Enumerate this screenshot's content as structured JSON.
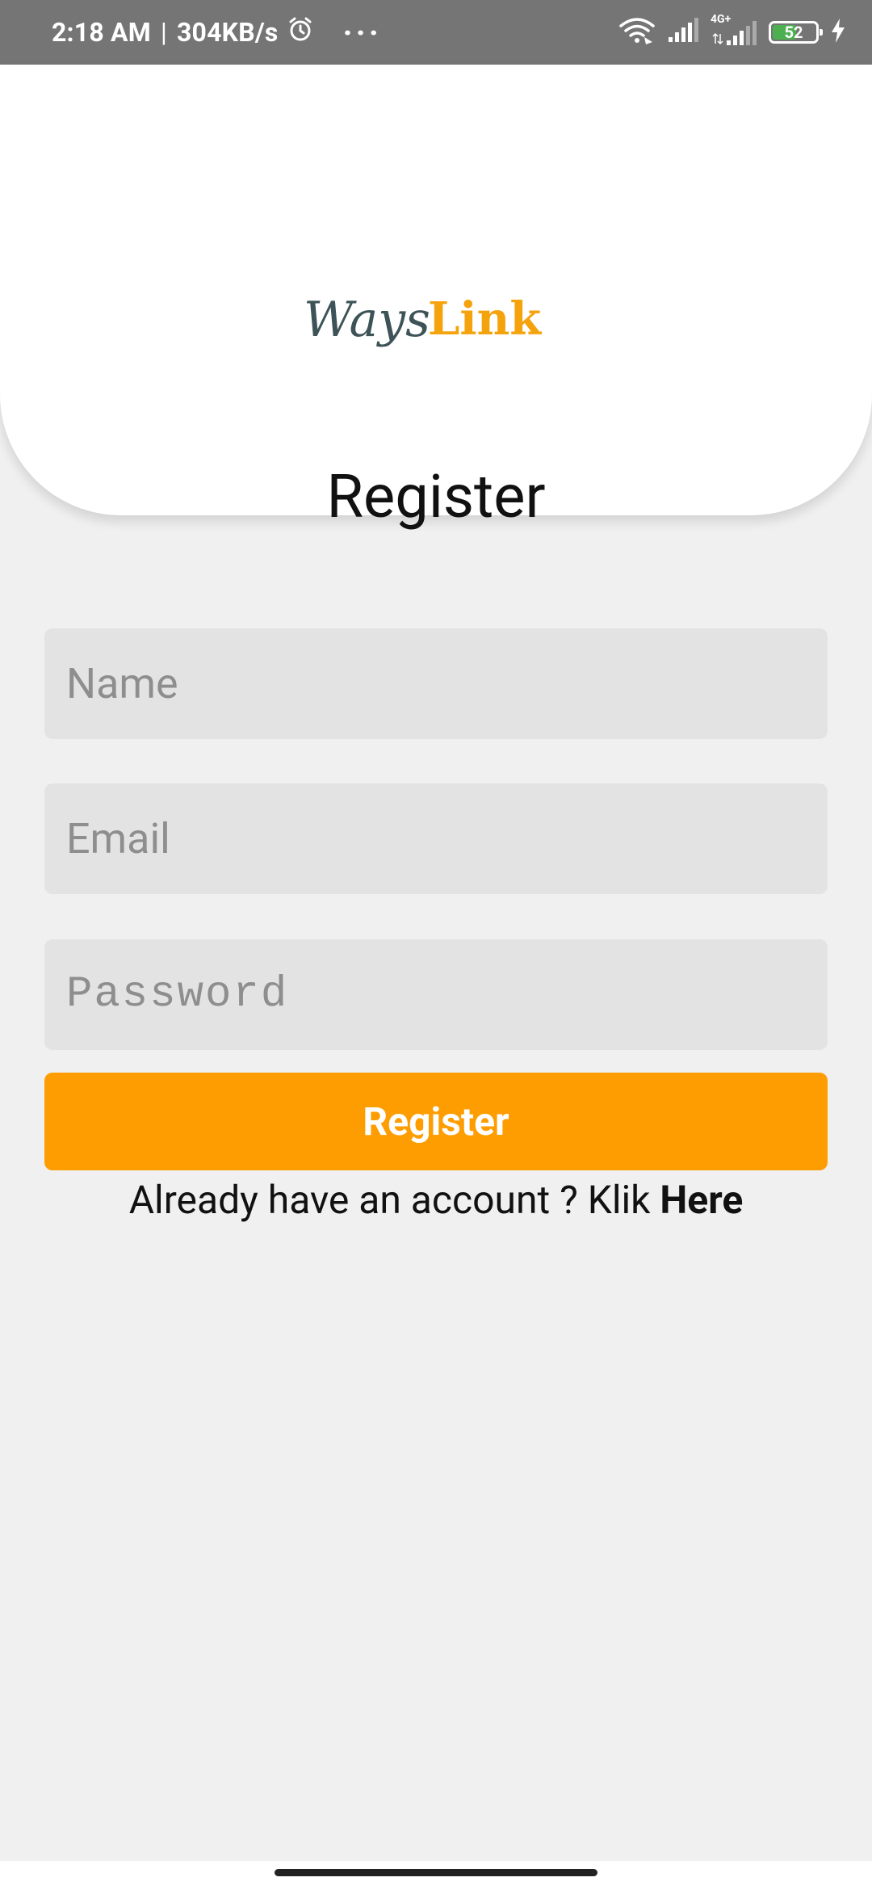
{
  "status_bar": {
    "time": "2:18 AM",
    "separator": "|",
    "speed": "304KB/s",
    "more": "···",
    "network_label": "4G+",
    "battery_level": "52",
    "icons": [
      "alarm-icon",
      "wifi-icon",
      "signal-icon",
      "signal-4g-icon",
      "battery-icon",
      "charging-icon"
    ]
  },
  "header": {
    "logo_text_part1": "Ways",
    "logo_text_part2": "Link",
    "title": "Register"
  },
  "form": {
    "name_placeholder": "Name",
    "email_placeholder": "Email",
    "password_placeholder": "Password",
    "submit_label": "Register"
  },
  "login_prompt": {
    "text": "Already have an account ? Klik ",
    "link": "Here"
  },
  "colors": {
    "accent": "#fd9d01",
    "status_bar": "#757575",
    "background": "#f0f0f0",
    "input_bg": "#e3e3e3",
    "logo_dark": "#3d5357"
  }
}
